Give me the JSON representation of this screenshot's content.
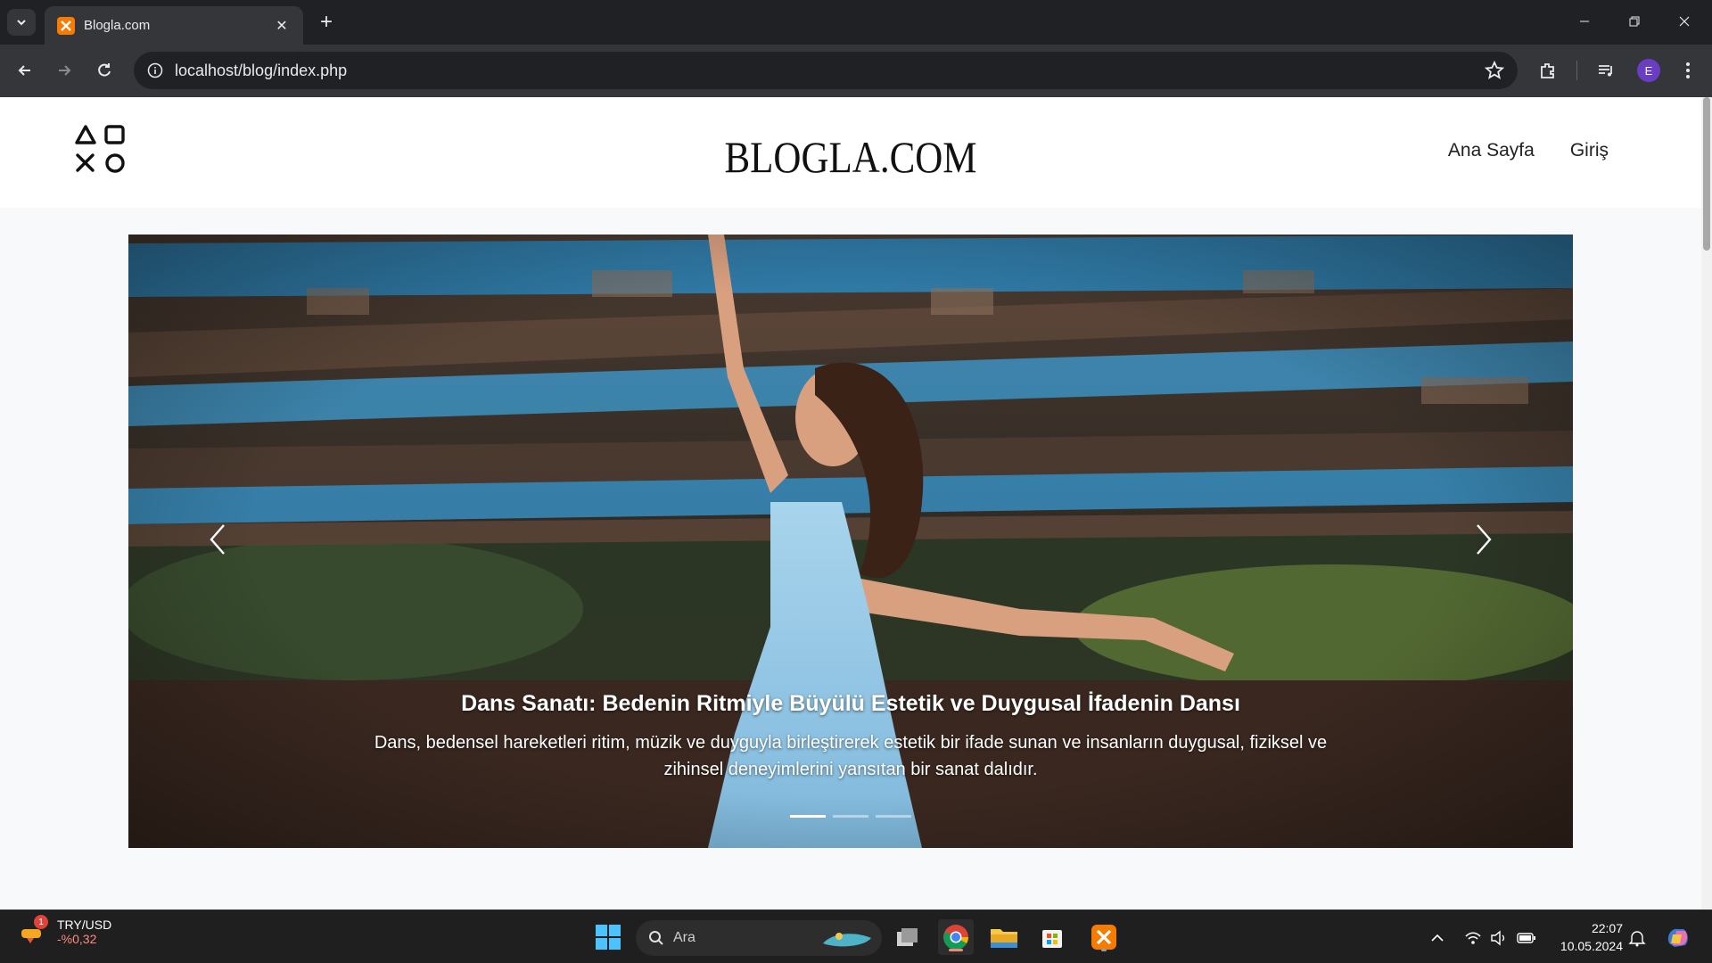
{
  "browser": {
    "tab_title": "Blogla.com",
    "url": "localhost/blog/index.php",
    "profile_initial": "E"
  },
  "site": {
    "brand": "BLOGLA.COM",
    "nav": [
      "Ana Sayfa",
      "Giriş"
    ]
  },
  "carousel": {
    "slide_title": "Dans Sanatı: Bedenin Ritmiyle Büyülü Estetik ve Duygusal İfadenin Dansı",
    "slide_text": "Dans, bedensel hareketleri ritim, müzik ve duyguyla birleştirerek estetik bir ifade sunan ve insanların duygusal, fiziksel ve zihinsel deneyimlerini yansıtan bir sanat dalıdır.",
    "slide_count": 3,
    "active_index": 0
  },
  "taskbar": {
    "widget_badge": "1",
    "widget_title": "TRY/USD",
    "widget_value": "-%0,32",
    "search_placeholder": "Ara",
    "time": "22:07",
    "date": "10.05.2024"
  },
  "colors": {
    "chrome_dark": "#202124",
    "chrome_toolbar": "#35363a",
    "page_bg": "#f8f9fa",
    "xampp_orange": "#f57c00"
  },
  "icons": [
    "tab-list-icon",
    "xampp-icon",
    "close-icon",
    "plus-icon",
    "minimize-icon",
    "restore-icon",
    "window-close-icon",
    "back-icon",
    "forward-icon",
    "reload-icon",
    "info-icon",
    "star-icon",
    "extensions-icon",
    "media-icon",
    "menu-icon",
    "shapes-logo-icon",
    "chevron-left-icon",
    "chevron-right-icon",
    "windows-start-icon",
    "search-icon",
    "task-view-icon",
    "chrome-icon",
    "file-explorer-icon",
    "store-icon",
    "wifi-icon",
    "volume-icon",
    "battery-icon",
    "chevron-up-icon",
    "notification-icon",
    "copilot-icon"
  ]
}
